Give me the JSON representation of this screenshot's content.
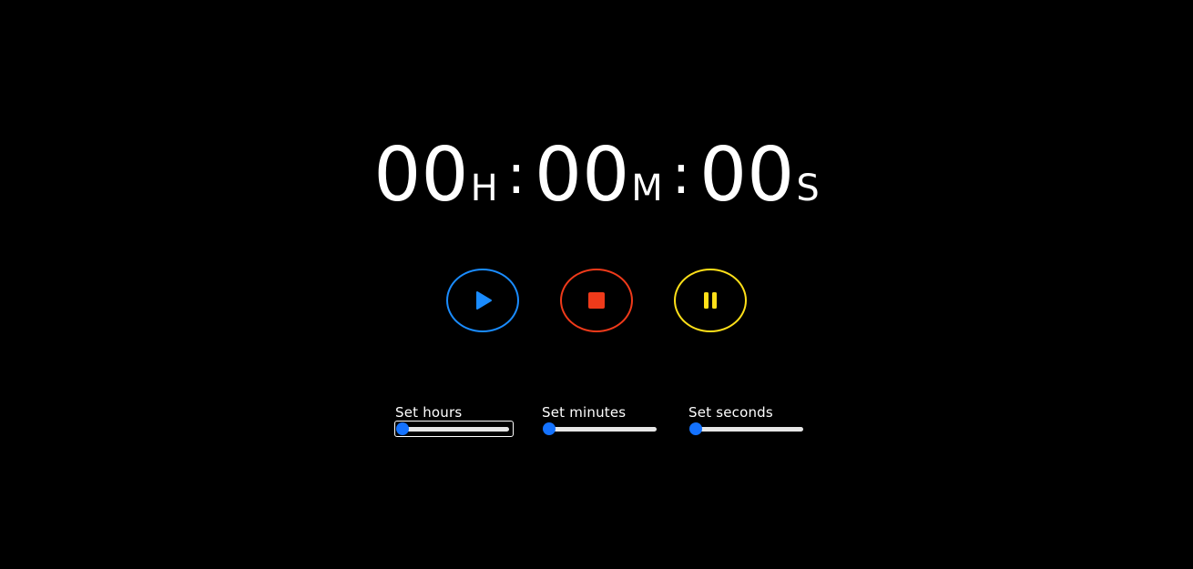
{
  "clock": {
    "hours": "00",
    "hours_unit": "H",
    "minutes": "00",
    "minutes_unit": "M",
    "seconds": "00",
    "seconds_unit": "S",
    "separator": ":"
  },
  "controls": {
    "play": {
      "icon": "play-icon",
      "color": "#1a8cff"
    },
    "stop": {
      "icon": "stop-icon",
      "color": "#ef3a1a"
    },
    "pause": {
      "icon": "pause-icon",
      "color": "#ffe019"
    }
  },
  "sliders": [
    {
      "label": "Set hours",
      "value": 0,
      "focused": true
    },
    {
      "label": "Set minutes",
      "value": 0,
      "focused": false
    },
    {
      "label": "Set seconds",
      "value": 0,
      "focused": false
    }
  ],
  "colors": {
    "background": "#000000",
    "text": "#ffffff",
    "slider_thumb": "#1472ff",
    "slider_track": "#e6e6e6"
  }
}
